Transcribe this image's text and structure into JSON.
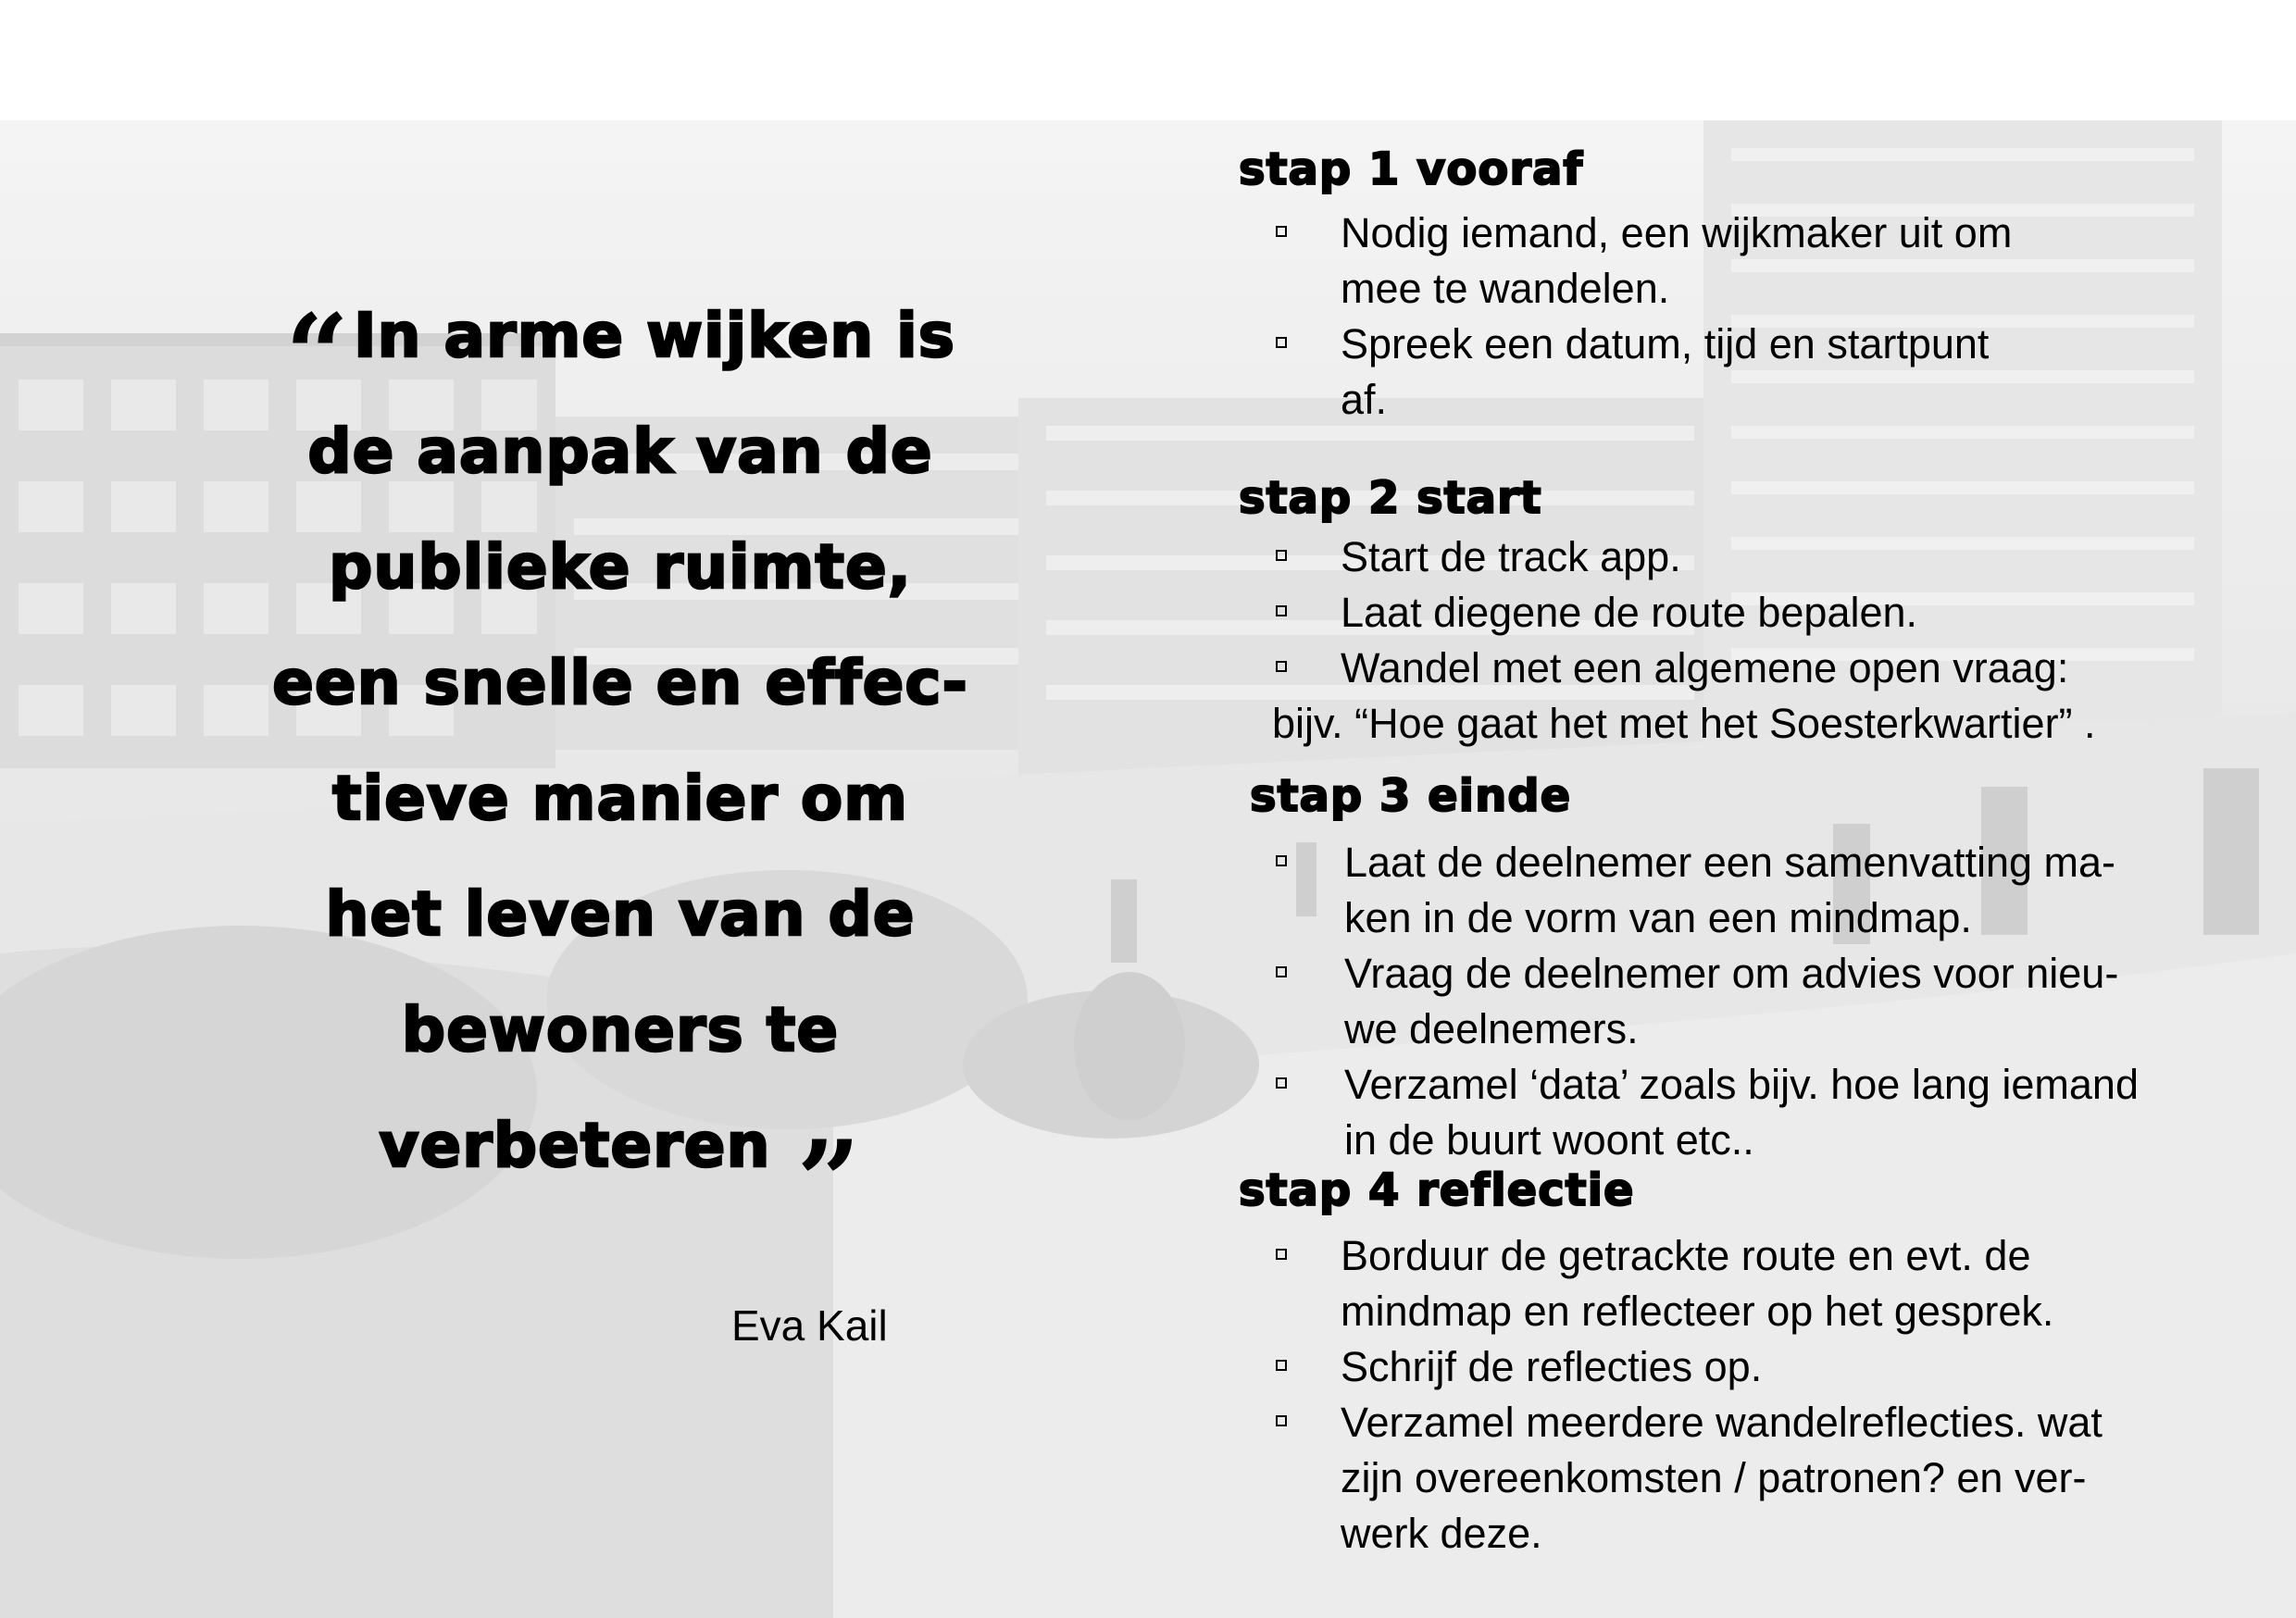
{
  "quote": {
    "open_mark": "“",
    "lines": [
      "In arme wijken is",
      "de aanpak van de",
      "publieke ruimte,",
      "een snelle en effec-",
      "tieve manier om",
      "het leven van de",
      "bewoners te",
      "verbeteren"
    ],
    "close_mark": "”",
    "author": "Eva Kail"
  },
  "steps": [
    {
      "title": "stap 1 vooraf",
      "items": [
        [
          "Nodig iemand, een wijkmaker uit om",
          "mee te wandelen."
        ],
        [
          "Spreek een datum, tijd en startpunt",
          "af."
        ]
      ]
    },
    {
      "title": "stap 2 start",
      "items": [
        [
          "Start de track app."
        ],
        [
          "Laat diegene de route bepalen."
        ],
        [
          "Wandel met een algemene open vraag:"
        ]
      ],
      "continuation": "bijv. “Hoe gaat het met het Soesterkwartier” ."
    },
    {
      "title": "stap 3 einde",
      "items": [
        [
          "Laat de deelnemer een samenvatting ma-",
          "ken in de vorm van een mindmap."
        ],
        [
          "Vraag de deelnemer om advies voor nieu-",
          "we deelnemers."
        ],
        [
          "Verzamel ‘data’  zoals bijv. hoe lang iemand",
          "in de buurt woont etc.."
        ]
      ]
    },
    {
      "title": "stap 4 reflectie",
      "items": [
        [
          "Borduur de getrackte route en evt. de",
          "mindmap en reflecteer op het gesprek."
        ],
        [
          "Schrijf de reflecties op."
        ],
        [
          "Verzamel meerdere wandelreflecties. wat",
          "zijn overeenkomsten / patronen? en ver-",
          "werk deze."
        ]
      ]
    }
  ]
}
